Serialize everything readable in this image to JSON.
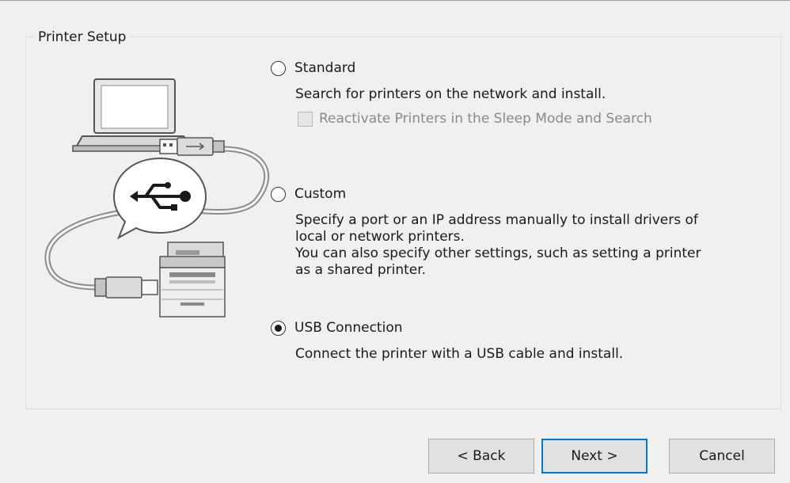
{
  "group": {
    "title": "Printer Setup"
  },
  "options": {
    "standard": {
      "label": "Standard",
      "description": "Search for printers on the network and install.",
      "checkbox_label": "Reactivate Printers in the Sleep Mode and Search",
      "checkbox_checked": false,
      "checkbox_enabled": false,
      "selected": false
    },
    "custom": {
      "label": "Custom",
      "description_lines": [
        "Specify a port or an IP address manually to install drivers of",
        "local or network printers.",
        "You can also specify other settings, such as setting a printer",
        "as a shared printer."
      ],
      "selected": false
    },
    "usb": {
      "label": "USB Connection",
      "description": "Connect the printer with a USB cable and install.",
      "selected": true
    }
  },
  "buttons": {
    "back": "< Back",
    "next": "Next >",
    "cancel": "Cancel"
  },
  "illustration": {
    "icons": [
      "laptop-icon",
      "usb-plug-icon",
      "usb-symbol-icon",
      "printer-icon"
    ]
  },
  "colors": {
    "background": "#f0f0f0",
    "default_button_border": "#0078d7",
    "disabled_text": "#8a8a8a"
  }
}
